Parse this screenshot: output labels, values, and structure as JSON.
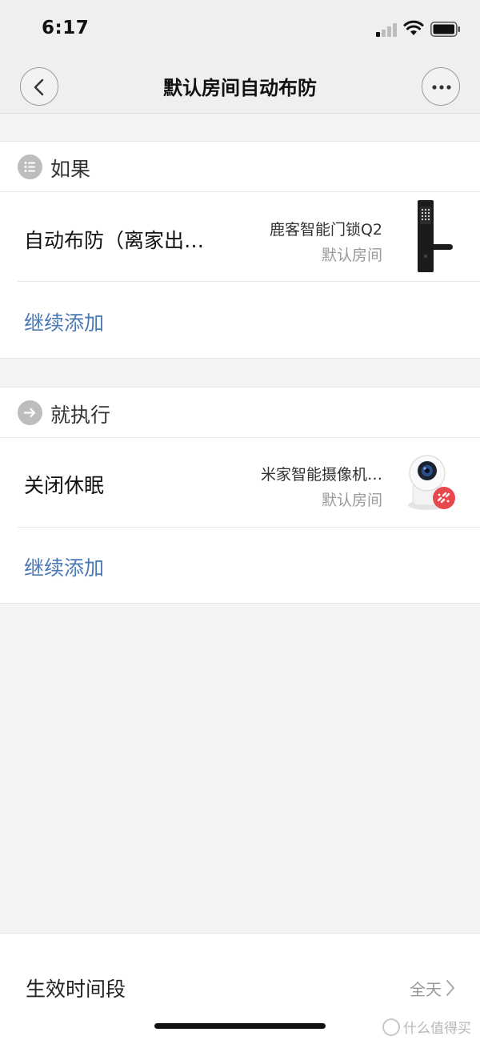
{
  "status_bar": {
    "time": "6:17"
  },
  "nav": {
    "title": "默认房间自动布防"
  },
  "if_section": {
    "title": "如果",
    "condition": {
      "name": "自动布防（离家出…",
      "device": "鹿客智能门锁Q2",
      "room": "默认房间"
    },
    "add_label": "继续添加"
  },
  "then_section": {
    "title": "就执行",
    "action": {
      "name": "关闭休眠",
      "device": "米家智能摄像机…",
      "room": "默认房间"
    },
    "add_label": "继续添加"
  },
  "schedule": {
    "label": "生效时间段",
    "value": "全天"
  },
  "watermark": "什么值得买",
  "colors": {
    "link": "#4a79b5",
    "badge": "#e8474c",
    "page_bg": "#f4f4f4"
  },
  "icons": [
    "back-icon",
    "more-icon",
    "list-icon",
    "arrow-right-icon",
    "door-lock-image",
    "camera-image",
    "unlink-icon",
    "chevron-right-icon"
  ]
}
